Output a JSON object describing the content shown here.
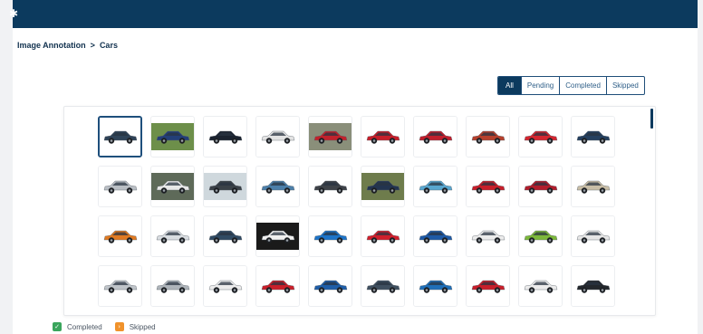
{
  "topbar": {
    "menu_icon": "menu-icon"
  },
  "breadcrumb": {
    "root": "Image Annotation",
    "separator": ">",
    "current": "Cars"
  },
  "filters": {
    "active": "All",
    "items": [
      "All",
      "Pending",
      "Completed",
      "Skipped"
    ]
  },
  "gallery": {
    "selected_index": 0,
    "tiles": [
      {
        "color": "#2f4358",
        "bg": "#ffffff"
      },
      {
        "color": "#233f78",
        "bg": "#6d8f4a"
      },
      {
        "color": "#1b2330",
        "bg": "#ffffff"
      },
      {
        "color": "#e3e3e3",
        "bg": "#ffffff"
      },
      {
        "color": "#c1222c",
        "bg": "#8a8f7a"
      },
      {
        "color": "#c71e2a",
        "bg": "#ffffff"
      },
      {
        "color": "#c11f2d",
        "bg": "#ffffff"
      },
      {
        "color": "#b6402c",
        "bg": "#ffffff"
      },
      {
        "color": "#d42630",
        "bg": "#ffffff"
      },
      {
        "color": "#25405f",
        "bg": "#ffffff"
      },
      {
        "color": "#b9bec4",
        "bg": "#ffffff"
      },
      {
        "color": "#e8e8e8",
        "bg": "#5e6a59"
      },
      {
        "color": "#3a4148",
        "bg": "#cfd8dd"
      },
      {
        "color": "#4c7fa9",
        "bg": "#ffffff"
      },
      {
        "color": "#3e4248",
        "bg": "#ffffff"
      },
      {
        "color": "#22344f",
        "bg": "#6e7c4c"
      },
      {
        "color": "#58a6cf",
        "bg": "#ffffff"
      },
      {
        "color": "#c71e2a",
        "bg": "#ffffff"
      },
      {
        "color": "#b11d2c",
        "bg": "#ffffff"
      },
      {
        "color": "#c8bda6",
        "bg": "#ffffff"
      },
      {
        "color": "#e07a22",
        "bg": "#ffffff"
      },
      {
        "color": "#d9dde1",
        "bg": "#ffffff"
      },
      {
        "color": "#304a63",
        "bg": "#ffffff"
      },
      {
        "color": "#f0f0f0",
        "bg": "#1a1a1a"
      },
      {
        "color": "#1e74c8",
        "bg": "#ffffff"
      },
      {
        "color": "#d01f2c",
        "bg": "#ffffff"
      },
      {
        "color": "#1e5aa6",
        "bg": "#ffffff"
      },
      {
        "color": "#ececec",
        "bg": "#ffffff"
      },
      {
        "color": "#7cb83a",
        "bg": "#ffffff"
      },
      {
        "color": "#e6e6e6",
        "bg": "#ffffff"
      },
      {
        "color": "#bfc4c9",
        "bg": "#ffffff"
      },
      {
        "color": "#aeb4ba",
        "bg": "#ffffff"
      },
      {
        "color": "#ececec",
        "bg": "#ffffff"
      },
      {
        "color": "#c91f2a",
        "bg": "#ffffff"
      },
      {
        "color": "#1f5ea8",
        "bg": "#ffffff"
      },
      {
        "color": "#3f4f5f",
        "bg": "#ffffff"
      },
      {
        "color": "#1f6fb8",
        "bg": "#ffffff"
      },
      {
        "color": "#c71e2a",
        "bg": "#ffffff"
      },
      {
        "color": "#ececec",
        "bg": "#ffffff"
      },
      {
        "color": "#23272c",
        "bg": "#ffffff"
      }
    ]
  },
  "legend": {
    "completed": {
      "label": "Completed",
      "color": "#3aa55c",
      "icon": "check-icon"
    },
    "skipped": {
      "label": "Skipped",
      "color": "#f0922b",
      "icon": "skip-icon"
    }
  }
}
